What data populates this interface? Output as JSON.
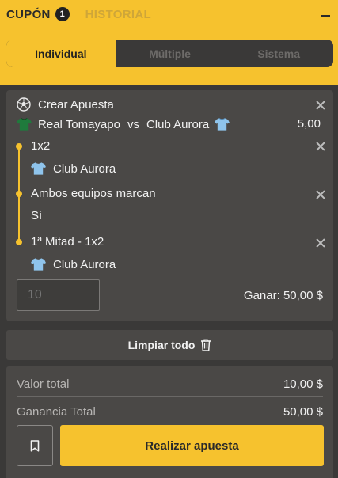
{
  "header": {
    "tab_cupon": "CUPÓN",
    "cupon_count": "1",
    "tab_historial": "HISTORIAL",
    "bet_types": [
      "Individual",
      "Múltiple",
      "Sistema"
    ],
    "active_bet_type": "Individual"
  },
  "bet": {
    "title": "Crear Apuesta",
    "home_team": "Real Tomayapo",
    "vs": "vs",
    "away_team": "Club Aurora",
    "odds": "5,00",
    "selections": [
      {
        "market": "1x2",
        "pick": "Club Aurora",
        "pick_icon": "jersey-light-blue-icon"
      },
      {
        "market": "Ambos equipos marcan",
        "pick": "Sí"
      },
      {
        "market": "1ª Mitad - 1x2",
        "pick": "Club Aurora",
        "pick_icon": "jersey-light-blue-icon"
      }
    ],
    "stake_placeholder": "10",
    "win_label": "Ganar:",
    "win_value": "50,00 $"
  },
  "clear_all": {
    "label": "Limpiar todo"
  },
  "summary": {
    "total_label": "Valor total",
    "total_value": "10,00 $",
    "profit_label": "Ganancia Total",
    "profit_value": "50,00 $",
    "place_bet_label": "Realizar apuesta"
  },
  "colors": {
    "accent": "#f6c22e",
    "panel": "#4a4846",
    "background": "#3a3938",
    "home_jersey": "#1f7a3c",
    "away_jersey": "#8fc4ec"
  }
}
